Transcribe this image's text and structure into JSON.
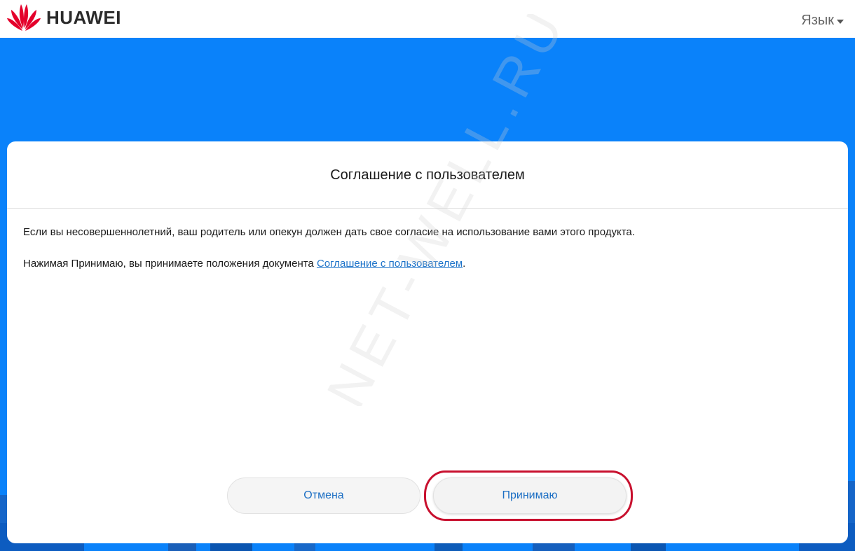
{
  "header": {
    "brand": "HUAWEI",
    "language_label": "Язык"
  },
  "dialog": {
    "title": "Соглашение с пользователем",
    "paragraph1": "Если вы несовершеннолетний, ваш родитель или опекун должен дать свое согласие на использование вами этого продукта.",
    "paragraph2_prefix": "Нажимая Принимаю, вы принимаете положения документа ",
    "paragraph2_link": "Соглашение с пользователем",
    "paragraph2_suffix": "."
  },
  "buttons": {
    "cancel": "Отмена",
    "accept": "Принимаю"
  },
  "watermark": "NET-WELL.RU",
  "colors": {
    "hero_blue": "#0a82fa",
    "brand_red": "#e4002b",
    "link_blue": "#1d73c9",
    "highlight_red": "#c8102e"
  },
  "icons": {
    "logo": "huawei-petal-logo-icon",
    "language_dropdown": "caret-down-icon"
  }
}
